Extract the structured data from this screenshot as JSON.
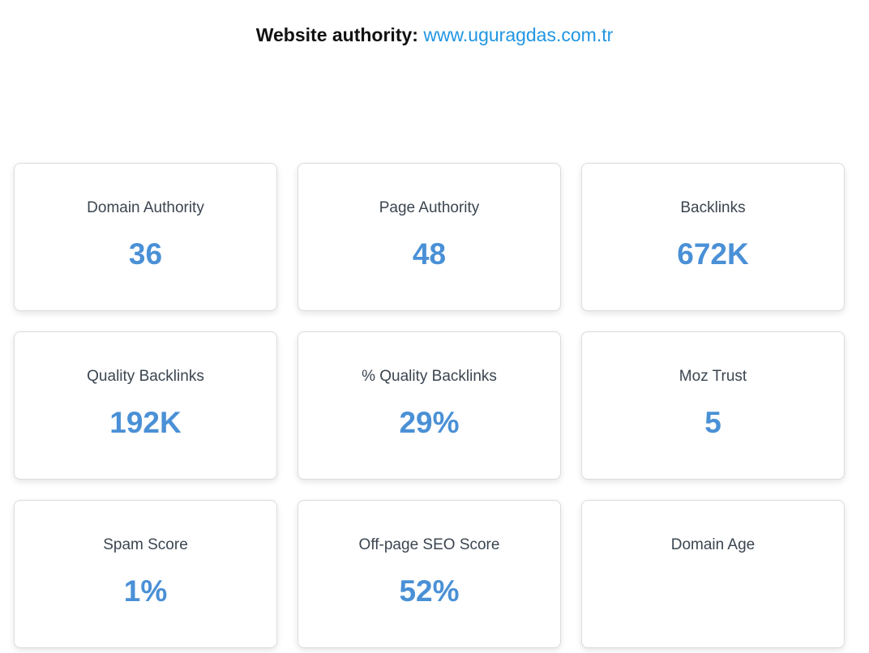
{
  "header": {
    "label": "Website authority:",
    "url": "www.uguragdas.com.tr"
  },
  "metrics": [
    {
      "title": "Domain Authority",
      "value": "36"
    },
    {
      "title": "Page Authority",
      "value": "48"
    },
    {
      "title": "Backlinks",
      "value": "672K"
    },
    {
      "title": "Quality Backlinks",
      "value": "192K"
    },
    {
      "title": "% Quality Backlinks",
      "value": "29%"
    },
    {
      "title": "Moz Trust",
      "value": "5"
    },
    {
      "title": "Spam Score",
      "value": "1%"
    },
    {
      "title": "Off-page SEO Score",
      "value": "52%"
    },
    {
      "title": "Domain Age",
      "value": ""
    }
  ],
  "colors": {
    "accent": "#4a90d6",
    "link": "#2196e3"
  }
}
